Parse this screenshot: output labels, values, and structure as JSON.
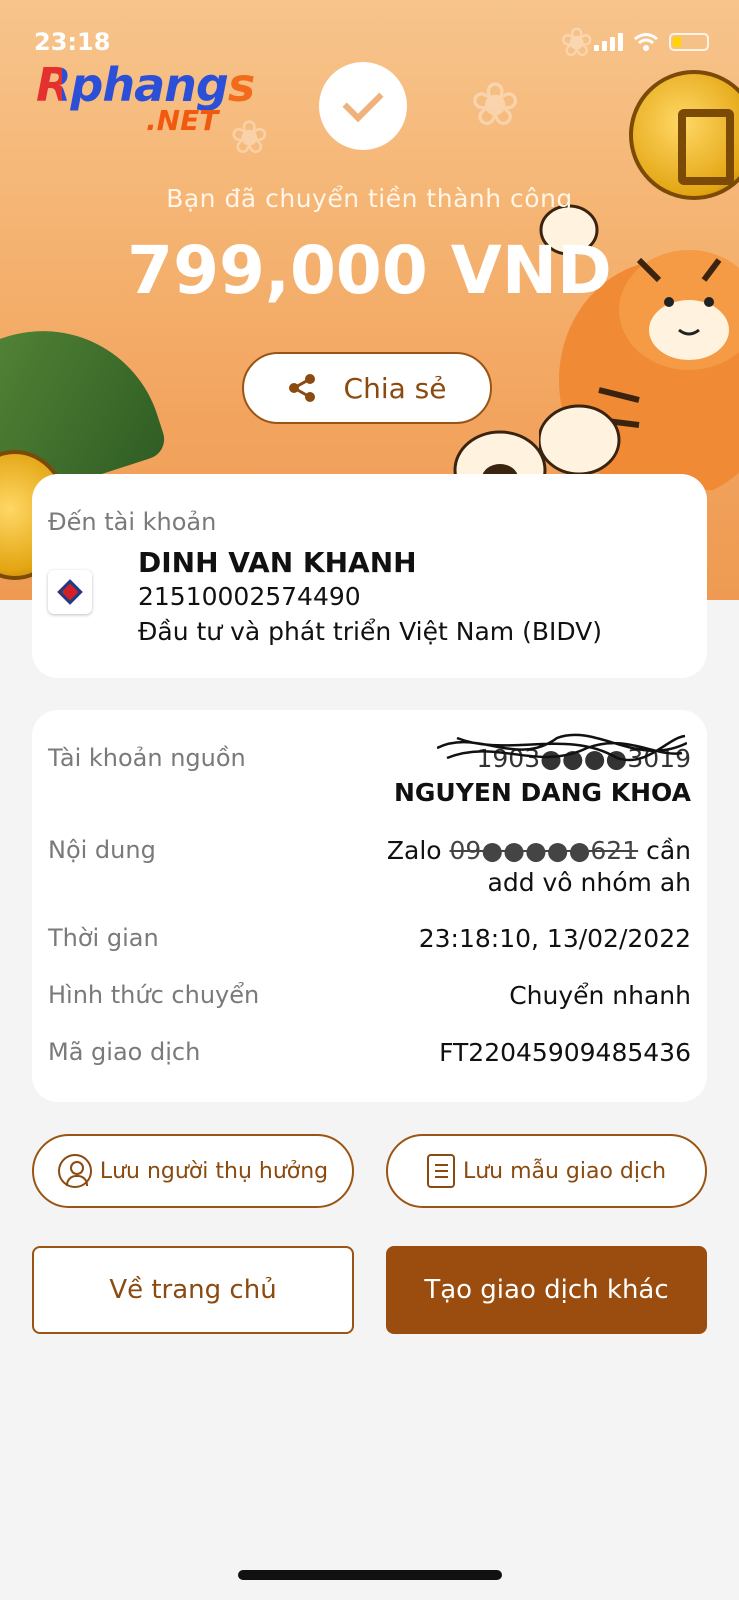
{
  "status_bar": {
    "time": "23:18"
  },
  "watermark": {
    "brand": "Rphangs",
    "suffix": ".NET"
  },
  "header": {
    "success_message": "Bạn đã chuyển tiền thành công",
    "amount": "799,000 VND",
    "share_label": "Chia sẻ"
  },
  "recipient": {
    "section_label": "Đến tài khoản",
    "name": "DINH VAN KHANH",
    "account_number": "21510002574490",
    "bank": "Đầu tư và phát triển Việt Nam (BIDV)"
  },
  "details": {
    "source_label": "Tài khoản nguồn",
    "source_account_redacted": "1903●●●●3019",
    "source_name": "NGUYEN DANG KHOA",
    "content_label": "Nội dung",
    "content_prefix": "Zalo",
    "content_redacted": "09●●●●●621",
    "content_suffix": "cần",
    "content_line2": "add vô nhóm ah",
    "time_label": "Thời gian",
    "time_value": "23:18:10, 13/02/2022",
    "method_label": "Hình thức chuyển",
    "method_value": "Chuyển nhanh",
    "txid_label": "Mã giao dịch",
    "txid_value": "FT22045909485436"
  },
  "actions": {
    "save_beneficiary": "Lưu người thụ hưởng",
    "save_template": "Lưu mẫu giao dịch",
    "home": "Về trang chủ",
    "new_transaction": "Tạo giao dịch khác"
  }
}
